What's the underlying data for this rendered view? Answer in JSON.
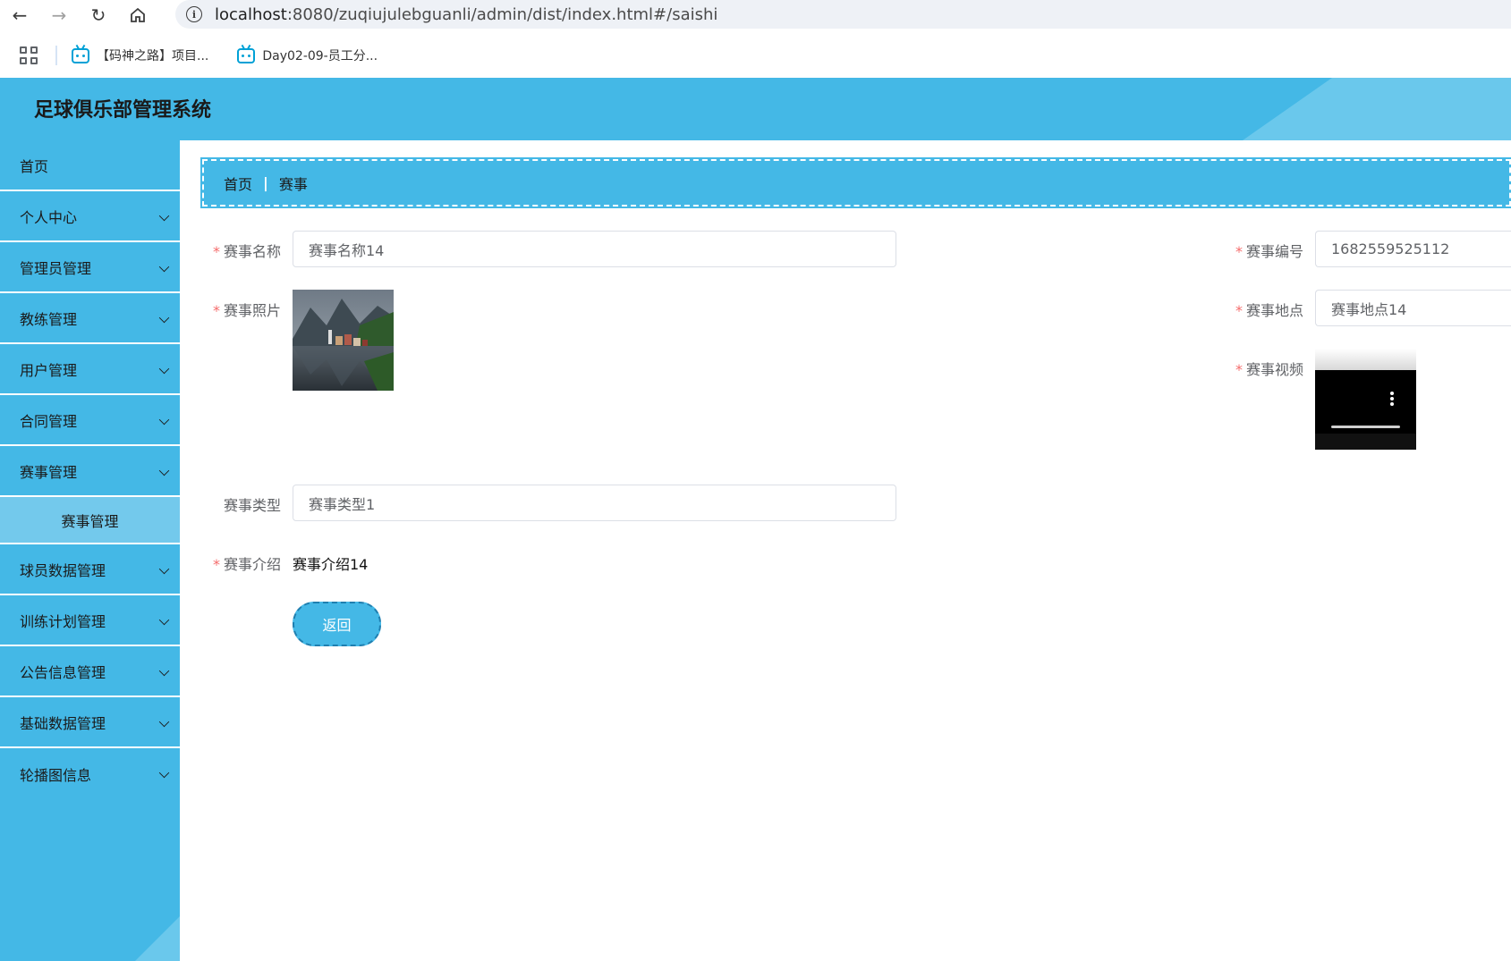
{
  "browser": {
    "url_host": "localhost",
    "url_path": ":8080/zuqiujulebguanli/admin/dist/index.html#/saishi",
    "bookmarks": [
      {
        "label": "【码神之路】项目..."
      },
      {
        "label": "Day02-09-员工分..."
      }
    ]
  },
  "app": {
    "title": "足球俱乐部管理系统"
  },
  "sidebar": {
    "items": [
      {
        "label": "首页",
        "expandable": false
      },
      {
        "label": "个人中心",
        "expandable": true
      },
      {
        "label": "管理员管理",
        "expandable": true
      },
      {
        "label": "教练管理",
        "expandable": true
      },
      {
        "label": "用户管理",
        "expandable": true
      },
      {
        "label": "合同管理",
        "expandable": true
      },
      {
        "label": "赛事管理",
        "expandable": true,
        "expanded": true
      }
    ],
    "submenu_label": "赛事管理",
    "items_after": [
      {
        "label": "球员数据管理",
        "expandable": true
      },
      {
        "label": "训练计划管理",
        "expandable": true
      },
      {
        "label": "公告信息管理",
        "expandable": true
      },
      {
        "label": "基础数据管理",
        "expandable": true
      },
      {
        "label": "轮播图信息",
        "expandable": true
      }
    ]
  },
  "breadcrumb": {
    "home": "首页",
    "separator": "|",
    "current": "赛事"
  },
  "form": {
    "required_mark": "*",
    "name_label": "赛事名称",
    "name_value": "赛事名称14",
    "number_label": "赛事编号",
    "number_value": "1682559525112",
    "photo_label": "赛事照片",
    "location_label": "赛事地点",
    "location_value": "赛事地点14",
    "video_label": "赛事视频",
    "type_label": "赛事类型",
    "type_value": "赛事类型1",
    "intro_label": "赛事介绍",
    "intro_value": "赛事介绍14",
    "back_label": "返回"
  },
  "colors": {
    "primary": "#44b8e6",
    "submenu": "#73c9ec",
    "required": "#f56c6c"
  }
}
